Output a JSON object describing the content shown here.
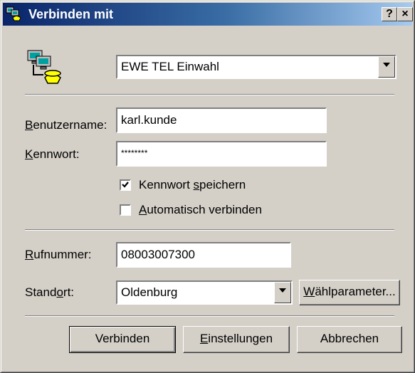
{
  "window": {
    "title": "Verbinden mit",
    "help_label": "?",
    "close_label": "×"
  },
  "connection": {
    "selected": "EWE TEL Einwahl",
    "icon": "dialup-connection-icon"
  },
  "fields": {
    "username": {
      "label_pre": "",
      "label_ul": "B",
      "label_post": "enutzername:",
      "value": "karl.kunde"
    },
    "password": {
      "label_pre": "",
      "label_ul": "K",
      "label_post": "ennwort:",
      "value": "********"
    },
    "phone": {
      "label_pre": "",
      "label_ul": "R",
      "label_post": "ufnummer:",
      "value": "08003007300"
    },
    "location": {
      "label_pre": "Stand",
      "label_ul": "o",
      "label_post": "rt:",
      "value": "Oldenburg"
    }
  },
  "checkboxes": {
    "save_password": {
      "label_pre": "Kennwort ",
      "label_ul": "s",
      "label_post": "peichern",
      "checked": true
    },
    "auto_connect": {
      "label_pre": "",
      "label_ul": "A",
      "label_post": "utomatisch verbinden",
      "checked": false
    }
  },
  "buttons": {
    "dial_properties": {
      "pre": "",
      "ul": "W",
      "post": "ählparameter..."
    },
    "connect": {
      "pre": "Verbinden",
      "ul": "",
      "post": ""
    },
    "settings": {
      "pre": "",
      "ul": "E",
      "post": "instellungen"
    },
    "cancel": {
      "pre": "Abbrechen",
      "ul": "",
      "post": ""
    }
  }
}
